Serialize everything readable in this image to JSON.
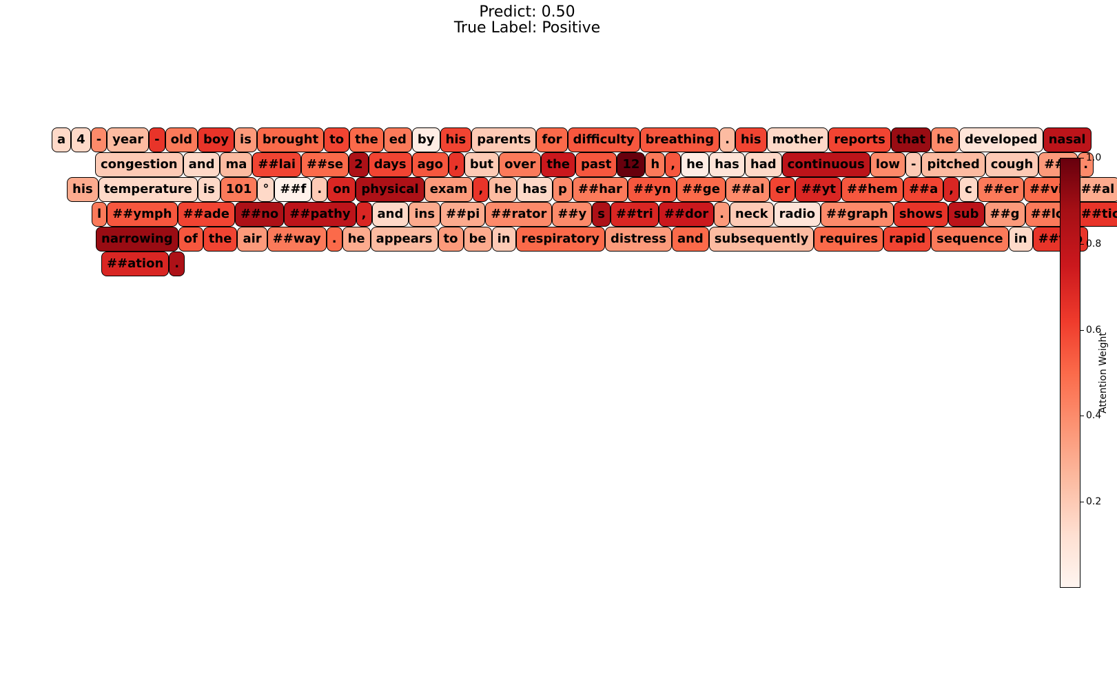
{
  "chart_data": {
    "type": "heatmap",
    "title_line1": "Predict: 0.50",
    "title_line2": "True Label: Positive",
    "colorbar": {
      "label": "Attention Weight",
      "range": [
        0.0,
        1.0
      ],
      "ticks": [
        "0.2",
        "0.4",
        "0.6",
        "0.8",
        "1.0"
      ],
      "colormap": "Reds"
    },
    "lines": [
      [
        {
          "t": "a",
          "w": 0.15
        },
        {
          "t": "4",
          "w": 0.15
        },
        {
          "t": "-",
          "w": 0.4
        },
        {
          "t": "year",
          "w": 0.25
        },
        {
          "t": "-",
          "w": 0.65
        },
        {
          "t": "old",
          "w": 0.45
        },
        {
          "t": "boy",
          "w": 0.65
        },
        {
          "t": "is",
          "w": 0.35
        },
        {
          "t": "brought",
          "w": 0.5
        },
        {
          "t": "to",
          "w": 0.6
        },
        {
          "t": "the",
          "w": 0.5
        },
        {
          "t": "ed",
          "w": 0.45
        },
        {
          "t": "by",
          "w": 0.05
        },
        {
          "t": "his",
          "w": 0.6
        },
        {
          "t": "parents",
          "w": 0.2
        },
        {
          "t": "for",
          "w": 0.5
        },
        {
          "t": "difficulty",
          "w": 0.55
        },
        {
          "t": "breathing",
          "w": 0.55
        },
        {
          "t": ".",
          "w": 0.25
        },
        {
          "t": "his",
          "w": 0.6
        },
        {
          "t": "mother",
          "w": 0.15
        },
        {
          "t": "reports",
          "w": 0.6
        },
        {
          "t": "that",
          "w": 0.9
        },
        {
          "t": "he",
          "w": 0.4
        },
        {
          "t": "developed",
          "w": 0.1
        },
        {
          "t": "nasal",
          "w": 0.8
        }
      ],
      [
        {
          "t": "congestion",
          "w": 0.2
        },
        {
          "t": "and",
          "w": 0.15
        },
        {
          "t": "ma",
          "w": 0.25
        },
        {
          "t": "##lai",
          "w": 0.6
        },
        {
          "t": "##se",
          "w": 0.5
        },
        {
          "t": "2",
          "w": 0.85
        },
        {
          "t": "days",
          "w": 0.6
        },
        {
          "t": "ago",
          "w": 0.55
        },
        {
          "t": ",",
          "w": 0.65
        },
        {
          "t": "but",
          "w": 0.2
        },
        {
          "t": "over",
          "w": 0.45
        },
        {
          "t": "the",
          "w": 0.75
        },
        {
          "t": "past",
          "w": 0.55
        },
        {
          "t": "12",
          "w": 1.0
        },
        {
          "t": "h",
          "w": 0.45
        },
        {
          "t": ",",
          "w": 0.55
        },
        {
          "t": "he",
          "w": 0.05
        },
        {
          "t": "has",
          "w": 0.1
        },
        {
          "t": "had",
          "w": 0.15
        },
        {
          "t": "continuous",
          "w": 0.8
        },
        {
          "t": "low",
          "w": 0.4
        },
        {
          "t": "-",
          "w": 0.2
        },
        {
          "t": "pitched",
          "w": 0.25
        },
        {
          "t": "cough",
          "w": 0.2
        },
        {
          "t": "##s",
          "w": 0.35
        },
        {
          "t": ".",
          "w": 0.4
        }
      ],
      [
        {
          "t": "his",
          "w": 0.3
        },
        {
          "t": "temperature",
          "w": 0.15
        },
        {
          "t": "is",
          "w": 0.15
        },
        {
          "t": "101",
          "w": 0.45
        },
        {
          "t": "°",
          "w": 0.15
        },
        {
          "t": "##f",
          "w": 0.02
        },
        {
          "t": ".",
          "w": 0.2
        },
        {
          "t": "on",
          "w": 0.7
        },
        {
          "t": "physical",
          "w": 0.85
        },
        {
          "t": "exam",
          "w": 0.35
        },
        {
          "t": ",",
          "w": 0.65
        },
        {
          "t": "he",
          "w": 0.25
        },
        {
          "t": "has",
          "w": 0.15
        },
        {
          "t": "p",
          "w": 0.4
        },
        {
          "t": "##har",
          "w": 0.45
        },
        {
          "t": "##yn",
          "w": 0.55
        },
        {
          "t": "##ge",
          "w": 0.5
        },
        {
          "t": "##al",
          "w": 0.4
        },
        {
          "t": "er",
          "w": 0.6
        },
        {
          "t": "##yt",
          "w": 0.7
        },
        {
          "t": "##hem",
          "w": 0.55
        },
        {
          "t": "##a",
          "w": 0.6
        },
        {
          "t": ",",
          "w": 0.7
        },
        {
          "t": "c",
          "w": 0.15
        },
        {
          "t": "##er",
          "w": 0.45
        },
        {
          "t": "##vic",
          "w": 0.5
        },
        {
          "t": "##al",
          "w": 0.3
        }
      ],
      [
        {
          "t": "l",
          "w": 0.45
        },
        {
          "t": "##ymph",
          "w": 0.55
        },
        {
          "t": "##ade",
          "w": 0.6
        },
        {
          "t": "##no",
          "w": 0.85
        },
        {
          "t": "##pathy",
          "w": 0.8
        },
        {
          "t": ",",
          "w": 0.7
        },
        {
          "t": "and",
          "w": 0.15
        },
        {
          "t": "ins",
          "w": 0.3
        },
        {
          "t": "##pi",
          "w": 0.3
        },
        {
          "t": "##rator",
          "w": 0.4
        },
        {
          "t": "##y",
          "w": 0.4
        },
        {
          "t": "s",
          "w": 0.85
        },
        {
          "t": "##tri",
          "w": 0.7
        },
        {
          "t": "##dor",
          "w": 0.75
        },
        {
          "t": ".",
          "w": 0.35
        },
        {
          "t": "neck",
          "w": 0.2
        },
        {
          "t": "radio",
          "w": 0.1
        },
        {
          "t": "##graph",
          "w": 0.4
        },
        {
          "t": "shows",
          "w": 0.65
        },
        {
          "t": "sub",
          "w": 0.8
        },
        {
          "t": "##g",
          "w": 0.35
        },
        {
          "t": "##lot",
          "w": 0.45
        },
        {
          "t": "##tic",
          "w": 0.65
        }
      ],
      [
        {
          "t": "narrowing",
          "w": 0.9
        },
        {
          "t": "of",
          "w": 0.55
        },
        {
          "t": "the",
          "w": 0.6
        },
        {
          "t": "air",
          "w": 0.35
        },
        {
          "t": "##way",
          "w": 0.45
        },
        {
          "t": ".",
          "w": 0.5
        },
        {
          "t": "he",
          "w": 0.3
        },
        {
          "t": "appears",
          "w": 0.25
        },
        {
          "t": "to",
          "w": 0.35
        },
        {
          "t": "be",
          "w": 0.3
        },
        {
          "t": "in",
          "w": 0.2
        },
        {
          "t": "respiratory",
          "w": 0.5
        },
        {
          "t": "distress",
          "w": 0.35
        },
        {
          "t": "and",
          "w": 0.5
        },
        {
          "t": "subsequently",
          "w": 0.25
        },
        {
          "t": "requires",
          "w": 0.5
        },
        {
          "t": "rapid",
          "w": 0.6
        },
        {
          "t": "sequence",
          "w": 0.45
        },
        {
          "t": "in",
          "w": 0.15
        },
        {
          "t": "##tub",
          "w": 0.65
        }
      ],
      [
        {
          "t": "##ation",
          "w": 0.7
        },
        {
          "t": ".",
          "w": 0.85
        }
      ]
    ]
  }
}
